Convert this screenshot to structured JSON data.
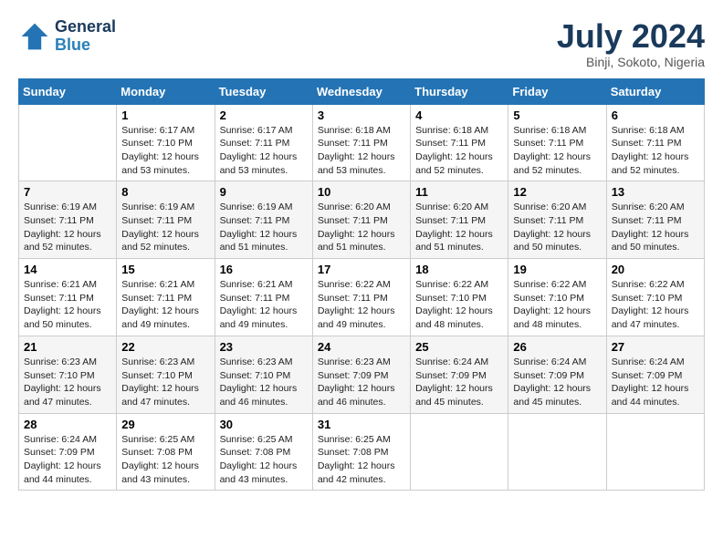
{
  "header": {
    "logo_line1": "General",
    "logo_line2": "Blue",
    "month_title": "July 2024",
    "location": "Binji, Sokoto, Nigeria"
  },
  "days_of_week": [
    "Sunday",
    "Monday",
    "Tuesday",
    "Wednesday",
    "Thursday",
    "Friday",
    "Saturday"
  ],
  "weeks": [
    [
      {
        "day": "",
        "text": ""
      },
      {
        "day": "1",
        "text": "Sunrise: 6:17 AM\nSunset: 7:10 PM\nDaylight: 12 hours\nand 53 minutes."
      },
      {
        "day": "2",
        "text": "Sunrise: 6:17 AM\nSunset: 7:11 PM\nDaylight: 12 hours\nand 53 minutes."
      },
      {
        "day": "3",
        "text": "Sunrise: 6:18 AM\nSunset: 7:11 PM\nDaylight: 12 hours\nand 53 minutes."
      },
      {
        "day": "4",
        "text": "Sunrise: 6:18 AM\nSunset: 7:11 PM\nDaylight: 12 hours\nand 52 minutes."
      },
      {
        "day": "5",
        "text": "Sunrise: 6:18 AM\nSunset: 7:11 PM\nDaylight: 12 hours\nand 52 minutes."
      },
      {
        "day": "6",
        "text": "Sunrise: 6:18 AM\nSunset: 7:11 PM\nDaylight: 12 hours\nand 52 minutes."
      }
    ],
    [
      {
        "day": "7",
        "text": "Sunrise: 6:19 AM\nSunset: 7:11 PM\nDaylight: 12 hours\nand 52 minutes."
      },
      {
        "day": "8",
        "text": "Sunrise: 6:19 AM\nSunset: 7:11 PM\nDaylight: 12 hours\nand 52 minutes."
      },
      {
        "day": "9",
        "text": "Sunrise: 6:19 AM\nSunset: 7:11 PM\nDaylight: 12 hours\nand 51 minutes."
      },
      {
        "day": "10",
        "text": "Sunrise: 6:20 AM\nSunset: 7:11 PM\nDaylight: 12 hours\nand 51 minutes."
      },
      {
        "day": "11",
        "text": "Sunrise: 6:20 AM\nSunset: 7:11 PM\nDaylight: 12 hours\nand 51 minutes."
      },
      {
        "day": "12",
        "text": "Sunrise: 6:20 AM\nSunset: 7:11 PM\nDaylight: 12 hours\nand 50 minutes."
      },
      {
        "day": "13",
        "text": "Sunrise: 6:20 AM\nSunset: 7:11 PM\nDaylight: 12 hours\nand 50 minutes."
      }
    ],
    [
      {
        "day": "14",
        "text": "Sunrise: 6:21 AM\nSunset: 7:11 PM\nDaylight: 12 hours\nand 50 minutes."
      },
      {
        "day": "15",
        "text": "Sunrise: 6:21 AM\nSunset: 7:11 PM\nDaylight: 12 hours\nand 49 minutes."
      },
      {
        "day": "16",
        "text": "Sunrise: 6:21 AM\nSunset: 7:11 PM\nDaylight: 12 hours\nand 49 minutes."
      },
      {
        "day": "17",
        "text": "Sunrise: 6:22 AM\nSunset: 7:11 PM\nDaylight: 12 hours\nand 49 minutes."
      },
      {
        "day": "18",
        "text": "Sunrise: 6:22 AM\nSunset: 7:10 PM\nDaylight: 12 hours\nand 48 minutes."
      },
      {
        "day": "19",
        "text": "Sunrise: 6:22 AM\nSunset: 7:10 PM\nDaylight: 12 hours\nand 48 minutes."
      },
      {
        "day": "20",
        "text": "Sunrise: 6:22 AM\nSunset: 7:10 PM\nDaylight: 12 hours\nand 47 minutes."
      }
    ],
    [
      {
        "day": "21",
        "text": "Sunrise: 6:23 AM\nSunset: 7:10 PM\nDaylight: 12 hours\nand 47 minutes."
      },
      {
        "day": "22",
        "text": "Sunrise: 6:23 AM\nSunset: 7:10 PM\nDaylight: 12 hours\nand 47 minutes."
      },
      {
        "day": "23",
        "text": "Sunrise: 6:23 AM\nSunset: 7:10 PM\nDaylight: 12 hours\nand 46 minutes."
      },
      {
        "day": "24",
        "text": "Sunrise: 6:23 AM\nSunset: 7:09 PM\nDaylight: 12 hours\nand 46 minutes."
      },
      {
        "day": "25",
        "text": "Sunrise: 6:24 AM\nSunset: 7:09 PM\nDaylight: 12 hours\nand 45 minutes."
      },
      {
        "day": "26",
        "text": "Sunrise: 6:24 AM\nSunset: 7:09 PM\nDaylight: 12 hours\nand 45 minutes."
      },
      {
        "day": "27",
        "text": "Sunrise: 6:24 AM\nSunset: 7:09 PM\nDaylight: 12 hours\nand 44 minutes."
      }
    ],
    [
      {
        "day": "28",
        "text": "Sunrise: 6:24 AM\nSunset: 7:09 PM\nDaylight: 12 hours\nand 44 minutes."
      },
      {
        "day": "29",
        "text": "Sunrise: 6:25 AM\nSunset: 7:08 PM\nDaylight: 12 hours\nand 43 minutes."
      },
      {
        "day": "30",
        "text": "Sunrise: 6:25 AM\nSunset: 7:08 PM\nDaylight: 12 hours\nand 43 minutes."
      },
      {
        "day": "31",
        "text": "Sunrise: 6:25 AM\nSunset: 7:08 PM\nDaylight: 12 hours\nand 42 minutes."
      },
      {
        "day": "",
        "text": ""
      },
      {
        "day": "",
        "text": ""
      },
      {
        "day": "",
        "text": ""
      }
    ]
  ]
}
